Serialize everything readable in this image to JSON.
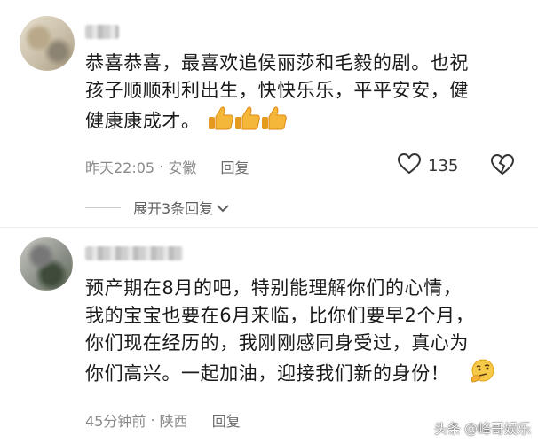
{
  "comments": [
    {
      "text_lines": [
        "恭喜恭喜，最喜欢追侯丽莎和毛毅的剧。也祝",
        "孩子顺顺利利出生，快快乐乐，平平安安，健",
        "健康康成才。"
      ],
      "emoji": "thumbs-up-icon x3",
      "time": "昨天22:05",
      "location": "安徽",
      "reply_label": "回复",
      "likes": "135",
      "expand_label": "展开3条回复"
    },
    {
      "text_lines": [
        "预产期在8月的吧，特别能理解你们的心情，",
        "我的宝宝也要在6月来临，比你们要早2个月，",
        "你们现在经历的，我刚刚感同身受过，真心为",
        "你们高兴。一起加油，迎接我们新的身份！"
      ],
      "emoji": "thinking-face-icon",
      "time": "45分钟前",
      "location": "陕西",
      "reply_label": "回复"
    }
  ],
  "watermark": {
    "prefix": "头条",
    "handle": "@峰哥娱乐"
  },
  "colors": {
    "meta": "#8a8a8a",
    "thumb": "#f2b233",
    "heart": "#e23b3b"
  }
}
